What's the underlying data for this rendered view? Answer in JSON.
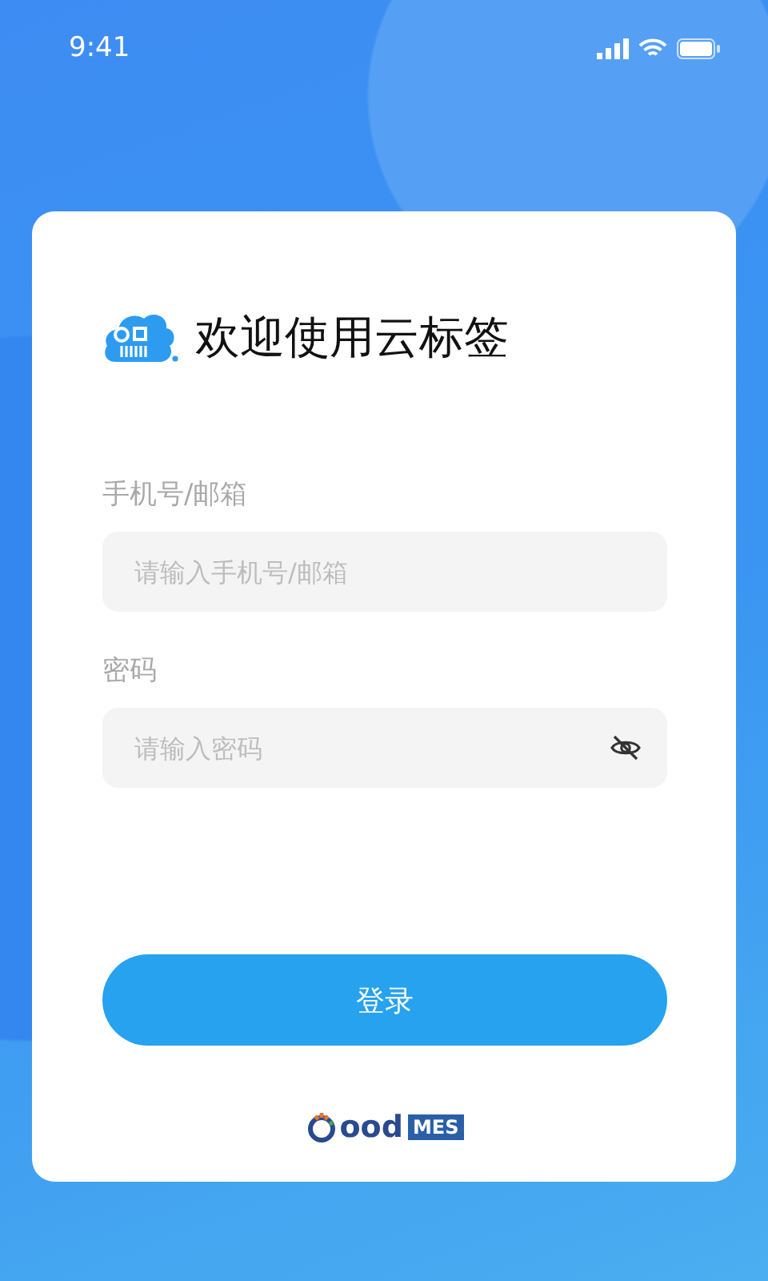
{
  "status_bar": {
    "time": "9:41"
  },
  "login_card": {
    "title": "欢迎使用云标签",
    "fields": [
      {
        "kind": "text",
        "label": "手机号/邮箱",
        "placeholder": "请输入手机号/邮箱"
      },
      {
        "kind": "password",
        "label": "密码",
        "placeholder": "请输入密码"
      }
    ],
    "login_button": "登录",
    "brand": {
      "name": "ood",
      "badge": "MES"
    }
  }
}
